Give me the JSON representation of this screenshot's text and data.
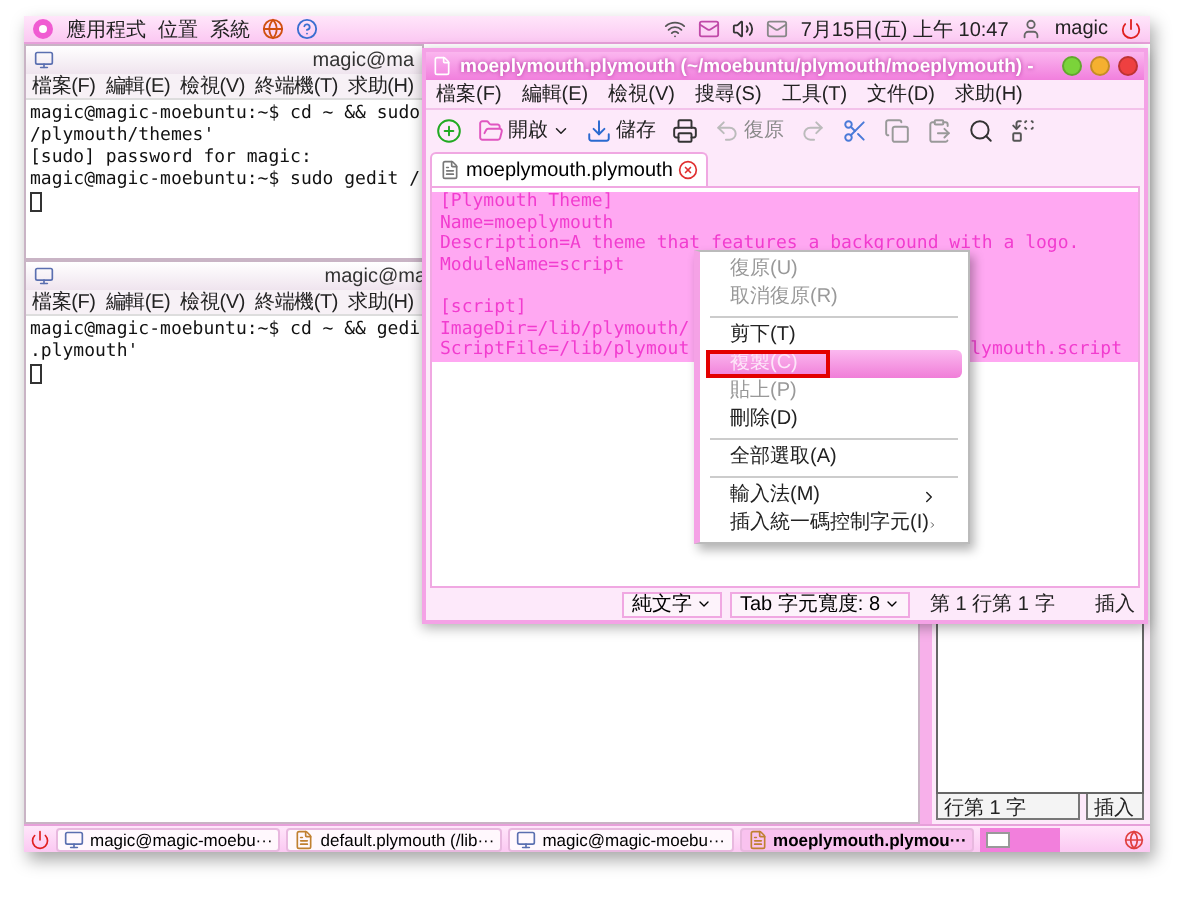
{
  "top_panel": {
    "menus": [
      "應用程式",
      "位置",
      "系統"
    ],
    "clock": "7月15日(五) 上午 10:47",
    "user": "magic"
  },
  "terminals": [
    {
      "title": "magic@ma",
      "menu": [
        "檔案(F)",
        "編輯(E)",
        "檢視(V)",
        "終端機(T)",
        "求助(H)"
      ],
      "lines": [
        {
          "kind": "text",
          "text": "magic@magic-moebuntu:~$ cd ~ && sudo"
        },
        {
          "kind": "text",
          "text": "/plymouth/themes'"
        },
        {
          "kind": "text",
          "text": "[sudo] password for magic:"
        },
        {
          "kind": "text",
          "text": "magic@magic-moebuntu:~$ sudo gedit /"
        },
        {
          "kind": "cursor"
        }
      ]
    },
    {
      "title": "magic@ma",
      "menu": [
        "檔案(F)",
        "編輯(E)",
        "檢視(V)",
        "終端機(T)",
        "求助(H)"
      ],
      "lines": [
        {
          "kind": "text",
          "text": "magic@magic-moebuntu:~$ cd ~ && gedi"
        },
        {
          "kind": "text",
          "text": ".plymouth'"
        },
        {
          "kind": "cursor"
        }
      ]
    }
  ],
  "editor_window": {
    "title": "moeplymouth.plymouth (~/moebuntu/plymouth/moeplymouth) -",
    "menu": [
      "檔案(F)",
      "編輯(E)",
      "檢視(V)",
      "搜尋(S)",
      "工具(T)",
      "文件(D)",
      "求助(H)"
    ],
    "toolbar": [
      {
        "kind": "new",
        "disabled": false
      },
      {
        "kind": "open",
        "label": "開啟",
        "disabled": false
      },
      {
        "kind": "save",
        "label": "儲存",
        "disabled": false
      },
      {
        "kind": "print",
        "disabled": false
      },
      {
        "kind": "undo",
        "label": "復原",
        "disabled": true
      },
      {
        "kind": "redo",
        "disabled": true
      },
      {
        "kind": "cut",
        "disabled": false
      },
      {
        "kind": "copy",
        "disabled": false
      },
      {
        "kind": "paste",
        "disabled": false
      },
      {
        "kind": "find",
        "disabled": false
      },
      {
        "kind": "replace",
        "disabled": false
      }
    ],
    "tab": {
      "label": "moeplymouth.plymouth"
    },
    "lines": [
      {
        "kind": "text",
        "segments": [
          "[Plymouth Theme]"
        ],
        "selected": true
      },
      {
        "kind": "text",
        "segments": [
          "Name=moeplymouth"
        ],
        "selected": true
      },
      {
        "kind": "text",
        "segments": [
          "Description=A theme that features a background with a logo."
        ],
        "selected": true
      },
      {
        "kind": "text",
        "segments": [
          "ModuleName=script"
        ],
        "selected": true
      },
      {
        "kind": "blank",
        "selected": true
      },
      {
        "kind": "text",
        "segments": [
          "[script]"
        ],
        "selected": true
      },
      {
        "kind": "text",
        "segments": [
          "ImageDir=/lib/plymouth/"
        ],
        "selected": true
      },
      {
        "kind": "text",
        "segments": [
          "ScriptFile=/lib/plymout",
          "lymouth.script"
        ],
        "selected": true
      }
    ],
    "context_menu": [
      {
        "kind": "item",
        "label": "復原(U)",
        "disabled": true,
        "selected": false,
        "submenu": false
      },
      {
        "kind": "item",
        "label": "取消復原(R)",
        "disabled": true,
        "selected": false,
        "submenu": false
      },
      {
        "kind": "separator"
      },
      {
        "kind": "item",
        "label": "剪下(T)",
        "disabled": false,
        "selected": false,
        "submenu": false
      },
      {
        "kind": "item",
        "label": "複製(C)",
        "disabled": false,
        "selected": true,
        "submenu": false
      },
      {
        "kind": "item",
        "label": "貼上(P)",
        "disabled": true,
        "selected": false,
        "submenu": false
      },
      {
        "kind": "item",
        "label": "刪除(D)",
        "disabled": false,
        "selected": false,
        "submenu": false
      },
      {
        "kind": "separator"
      },
      {
        "kind": "item",
        "label": "全部選取(A)",
        "disabled": false,
        "selected": false,
        "submenu": false
      },
      {
        "kind": "separator"
      },
      {
        "kind": "item",
        "label": "輸入法(M)",
        "disabled": false,
        "selected": false,
        "submenu": true
      },
      {
        "kind": "item",
        "label": "插入統一碼控制字元(I)",
        "disabled": false,
        "selected": false,
        "submenu": true
      }
    ],
    "status_bar": {
      "language": "純文字",
      "tab_width": "Tab 字元寬度: 8",
      "position": "第 1 行第 1 字",
      "mode": "插入"
    }
  },
  "background_window": {
    "status_bar": {
      "position": "行第 1 字",
      "mode": "插入"
    }
  },
  "taskbar": {
    "tasks": [
      {
        "kind": "terminal",
        "label": "magic@magic-moebu···",
        "selected": false
      },
      {
        "kind": "editor",
        "label": "default.plymouth (/lib···",
        "selected": false
      },
      {
        "kind": "terminal",
        "label": "magic@magic-moebu···",
        "selected": false
      },
      {
        "kind": "editor",
        "label": "moeplymouth.plymou···",
        "selected": true
      }
    ]
  }
}
